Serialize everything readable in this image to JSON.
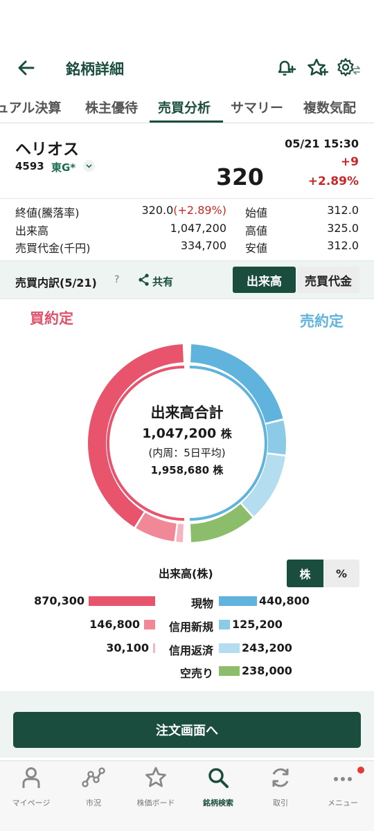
{
  "header": {
    "title": "銘柄詳細"
  },
  "tabs": [
    {
      "label": "ュアル決算"
    },
    {
      "label": "株主優待"
    },
    {
      "label": "売買分析"
    },
    {
      "label": "サマリー"
    },
    {
      "label": "複数気配"
    }
  ],
  "stock": {
    "name": "ヘリオス",
    "code": "4593",
    "market": "東G*",
    "time": "05/21 15:30",
    "change": "+9",
    "change_pct": "+2.89%",
    "price": "320"
  },
  "stats": {
    "close_label": "終値(騰落率)",
    "close_value": "320.0",
    "close_pct": "(+2.89%)",
    "open_label": "始値",
    "open_value": "312.0",
    "volume_label": "出来高",
    "volume_value": "1,047,200",
    "high_label": "高値",
    "high_value": "325.0",
    "turnover_label": "売買代金(千円)",
    "turnover_value": "334,700",
    "low_label": "安値",
    "low_value": "312.0"
  },
  "breakdown": {
    "title": "売買内訳(5/21)",
    "help": "?",
    "share_label": "共有",
    "toggle_volume": "出来高",
    "toggle_turnover": "売買代金",
    "buy_label": "買約定",
    "sell_label": "売約定",
    "center_title": "出来高合計",
    "center_total": "1,047,200",
    "center_unit": "株",
    "center_sub": "(内周：5日平均)",
    "center_avg": "1,958,680",
    "center_avg_unit": "株"
  },
  "volume_table": {
    "title": "出来高(株)",
    "unit_shares": "株",
    "unit_pct": "%",
    "rows": [
      {
        "name": "現物",
        "buy": "870,300",
        "sell": "440,800",
        "buy_num": 870300,
        "sell_num": 440800
      },
      {
        "name": "信用新規",
        "buy": "146,800",
        "sell": "125,200",
        "buy_num": 146800,
        "sell_num": 125200
      },
      {
        "name": "信用返済",
        "buy": "30,100",
        "sell": "243,200",
        "buy_num": 30100,
        "sell_num": 243200
      },
      {
        "name": "空売り",
        "buy": "",
        "sell": "238,000",
        "buy_num": 0,
        "sell_num": 238000
      }
    ]
  },
  "colors": {
    "brand": "#1a4d3d",
    "buy_cash": "#e8546c",
    "buy_margin_new": "#f08898",
    "buy_margin_repay": "#f5b5bf",
    "sell_cash": "#5fb3dc",
    "sell_margin_new": "#8ccbe8",
    "sell_margin_repay": "#b5ddf0",
    "short_sell": "#8bbd6a",
    "up": "#c62828"
  },
  "chart_data": {
    "type": "donut",
    "outer": {
      "buy": [
        870300,
        146800,
        30100
      ],
      "sell": [
        440800,
        125200,
        243200,
        238000
      ]
    }
  },
  "order_button": "注文画面へ",
  "nav": [
    {
      "label": "マイページ",
      "icon": "person-icon"
    },
    {
      "label": "市況",
      "icon": "market-icon"
    },
    {
      "label": "株価ボード",
      "icon": "star-icon"
    },
    {
      "label": "銘柄検索",
      "icon": "search-icon"
    },
    {
      "label": "取引",
      "icon": "trade-icon"
    },
    {
      "label": "メニュー",
      "icon": "menu-icon"
    }
  ]
}
